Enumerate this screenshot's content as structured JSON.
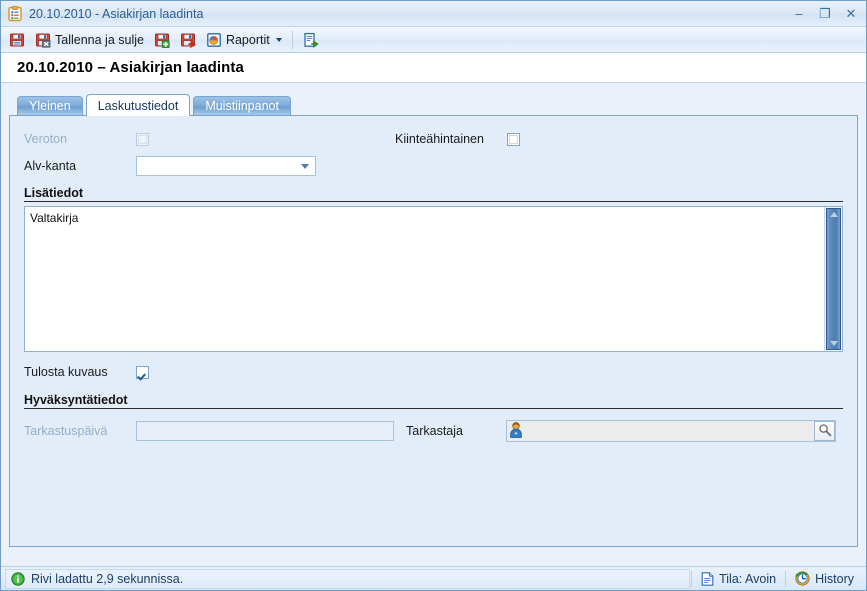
{
  "window": {
    "title": "20.10.2010 - Asiakirjan laadinta",
    "icon": "clipboard-icon",
    "controls": {
      "minimize": "–",
      "maximize": "❐",
      "close": "✕"
    }
  },
  "toolbar": {
    "items": [
      {
        "id": "save",
        "label": "",
        "icon": "save-icon"
      },
      {
        "id": "save-and-close",
        "label": "Tallenna ja sulje",
        "icon": "save-close-icon"
      },
      {
        "id": "save-and-new",
        "label": "",
        "icon": "save-new-icon"
      },
      {
        "id": "save-and-next",
        "label": "",
        "icon": "save-next-icon"
      },
      {
        "id": "reports",
        "label": "Raportit",
        "icon": "reports-icon",
        "has_dropdown": true
      },
      {
        "id": "export",
        "label": "",
        "icon": "export-icon"
      }
    ]
  },
  "header": {
    "title": "20.10.2010 – Asiakirjan laadinta"
  },
  "tabs": [
    {
      "id": "yleinen",
      "label": "Yleinen",
      "active": false
    },
    {
      "id": "laskutustiedot",
      "label": "Laskutustiedot",
      "active": true
    },
    {
      "id": "muistiinpanot",
      "label": "Muistiinpanot",
      "active": false
    }
  ],
  "form": {
    "veroton": {
      "label": "Veroton",
      "checked": false,
      "disabled": true
    },
    "kiinteahintainen": {
      "label": "Kiinteähintainen",
      "checked": false,
      "disabled": false
    },
    "alv_kanta": {
      "label": "Alv-kanta",
      "value": "",
      "placeholder": ""
    },
    "lisatiedot": {
      "section_title": "Lisätiedot",
      "value": "Valtakirja"
    },
    "tulosta_kuvaus": {
      "label": "Tulosta kuvaus",
      "checked": true
    },
    "hyvaksyntatiedot": {
      "section_title": "Hyväksyntätiedot"
    },
    "tarkastuspaiva": {
      "label": "Tarkastuspäivä",
      "value": "",
      "disabled": true
    },
    "tarkastaja": {
      "label": "Tarkastaja",
      "value": "",
      "icon": "person-icon",
      "button_icon": "magnifier-icon"
    }
  },
  "statusbar": {
    "message": "Rivi ladattu 2,9 sekunnissa.",
    "message_icon": "info-icon",
    "state": {
      "label": "Tila: Avoin",
      "icon": "document-icon"
    },
    "history": {
      "label": "History",
      "icon": "history-icon"
    }
  },
  "colors": {
    "accent": "#1d5d9e",
    "panel_bg": "#e3edf9",
    "title_text": "#2a5d91",
    "tab_active_bg": "#ffffff",
    "tab_inactive_bg": "#7fabd8"
  }
}
